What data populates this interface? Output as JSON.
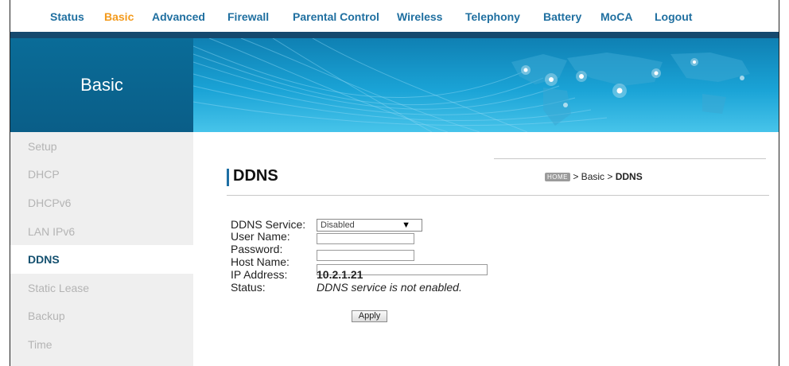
{
  "topnav": {
    "items": [
      "Status",
      "Basic",
      "Advanced",
      "Firewall",
      "Parental Control",
      "Wireless",
      "Telephony",
      "Battery",
      "MoCA",
      "Logout"
    ],
    "active": "Basic"
  },
  "banner": {
    "title": "Basic"
  },
  "sidebar": {
    "items": [
      "Setup",
      "DHCP",
      "DHCPv6",
      "LAN IPv6",
      "DDNS",
      "Static Lease",
      "Backup",
      "Time"
    ],
    "active": "DDNS"
  },
  "page": {
    "title": "DDNS",
    "breadcrumb": {
      "home": "HOME",
      "sep1": "> Basic >",
      "current": "DDNS"
    }
  },
  "form": {
    "ddns_service_label": "DDNS Service:",
    "ddns_service_value": "Disabled",
    "user_name_label": "User Name:",
    "password_label": "Password:",
    "host_name_label": "Host Name:",
    "ip_address_label": "IP Address:",
    "ip_address_value": "10.2.1.21",
    "status_label": "Status:",
    "status_value": "DDNS service is not enabled.",
    "apply_label": "Apply"
  },
  "colors": {
    "nav_text": "#1f6fa0",
    "nav_active": "#f39a1c",
    "banner": "#0a6c98"
  }
}
